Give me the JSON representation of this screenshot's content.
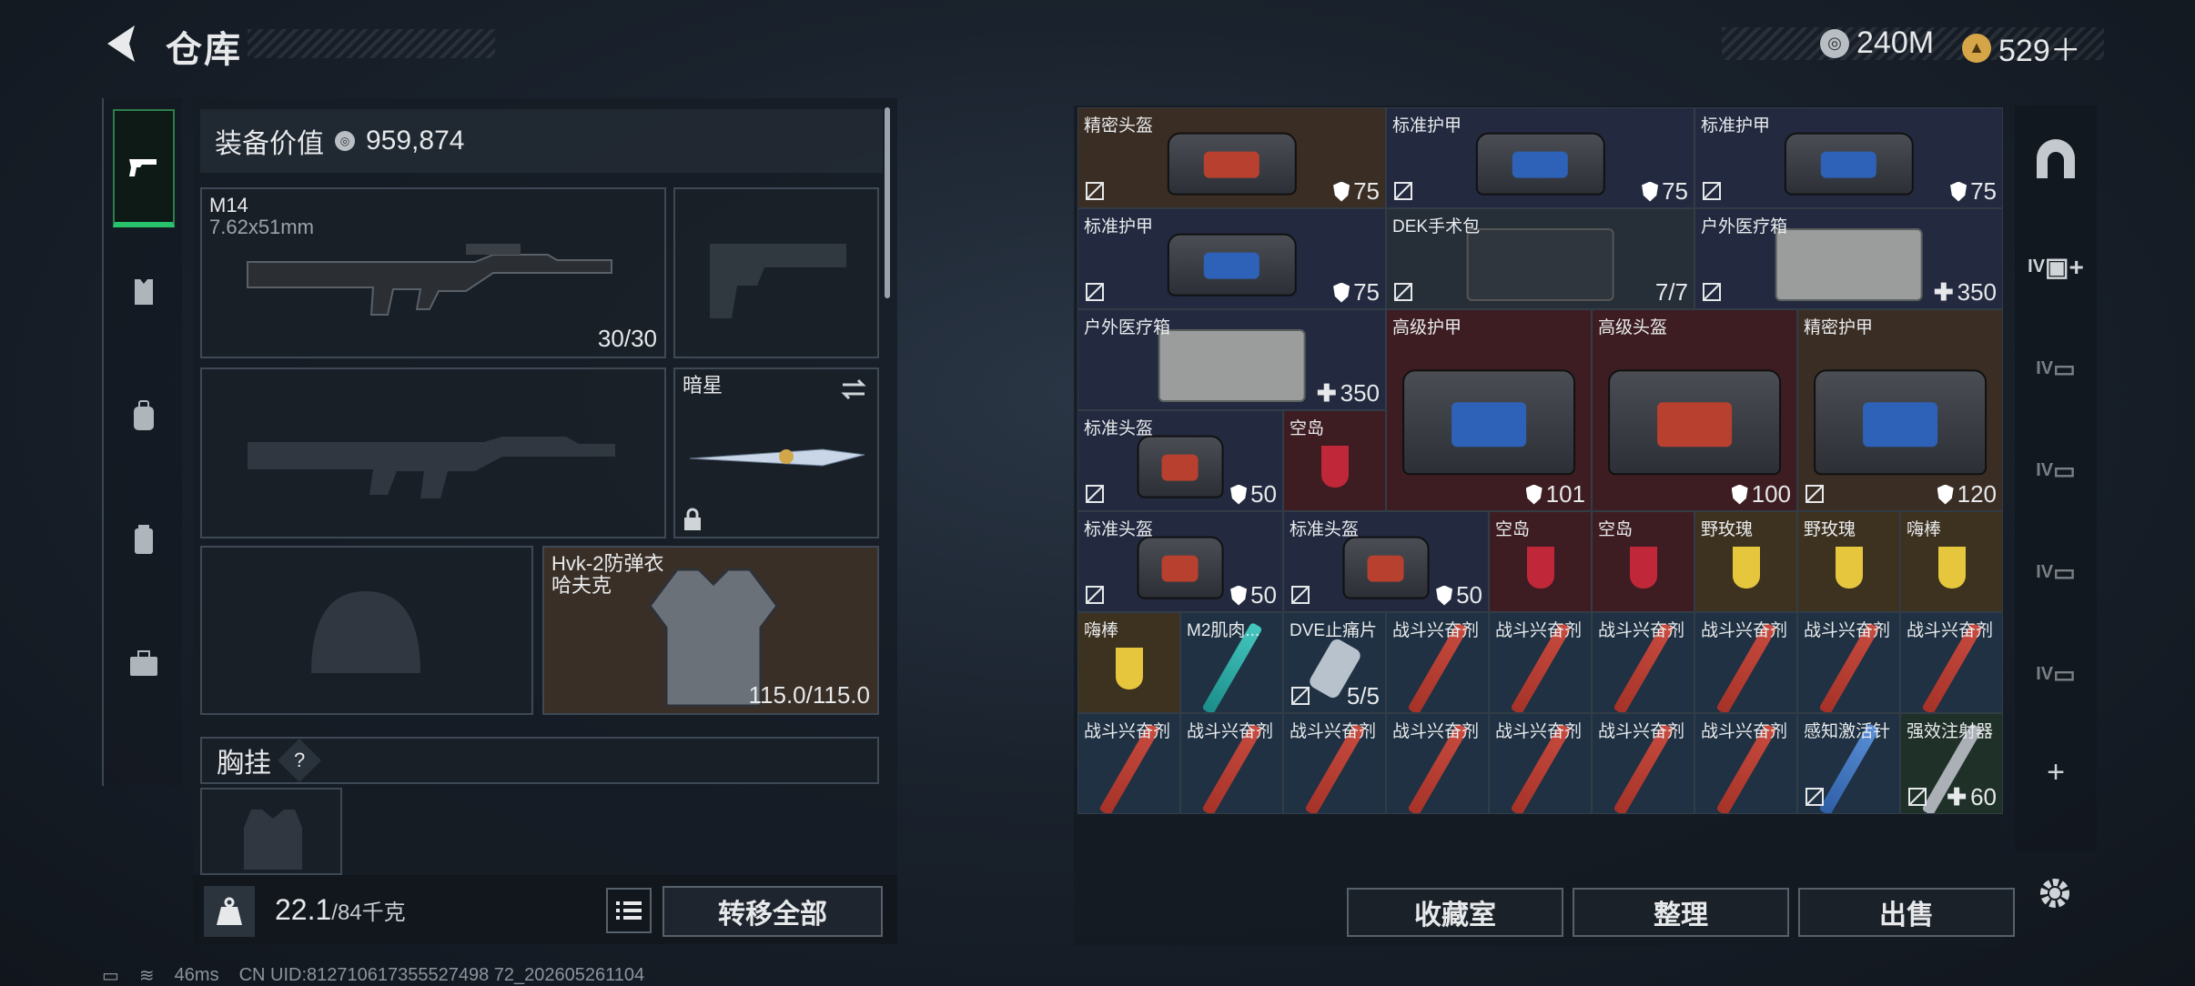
{
  "header": {
    "title": "仓库"
  },
  "currency": [
    {
      "icon": "silver-coin-icon",
      "value": "240M"
    },
    {
      "icon": "gold-coin-icon",
      "value": "529＋"
    }
  ],
  "loadout": {
    "value_label": "装备价值",
    "value": "959,874",
    "primary": {
      "name": "M14",
      "caliber": "7.62x51mm",
      "ammo": "30/30"
    },
    "melee": {
      "name": "暗星"
    },
    "armor": {
      "name": "Hvk-2防弹衣",
      "subname": "哈夫克",
      "durability": "115.0/115.0"
    },
    "chest_rig": {
      "label": "胸挂",
      "hint": "?"
    },
    "weight": {
      "current": "22.1",
      "max": "/84千克"
    },
    "transfer_all": "转移全部"
  },
  "stash": [
    [
      {
        "name": "精密头盔",
        "count": "75",
        "kind": "shield"
      },
      {
        "name": "标准护甲",
        "count": "75",
        "kind": "shield"
      },
      {
        "name": "标准护甲",
        "count": "75",
        "kind": "shield"
      }
    ],
    [
      {
        "name": "标准护甲",
        "count": "75",
        "kind": "shield"
      },
      {
        "name": "DEK手术包",
        "count": "7/7",
        "kind": "plain"
      },
      {
        "name": "户外医疗箱",
        "count": "350",
        "kind": "plus"
      }
    ],
    [
      {
        "name": "户外医疗箱",
        "count": "350",
        "kind": "plus"
      },
      {
        "name": "高级护甲",
        "count": "101",
        "kind": "shield"
      },
      {
        "name": "高级头盔",
        "count": "100",
        "kind": "shield"
      },
      {
        "name": "精密护甲",
        "count": "120",
        "kind": "shield"
      }
    ],
    [
      {
        "name": "标准头盔",
        "count": "50",
        "kind": "shield"
      },
      {
        "name": "空岛",
        "count": "",
        "kind": "none"
      }
    ],
    [
      {
        "name": "标准头盔",
        "count": "50",
        "kind": "shield"
      },
      {
        "name": "标准头盔",
        "count": "50",
        "kind": "shield"
      },
      {
        "name": "空岛",
        "count": "",
        "kind": "none"
      },
      {
        "name": "空岛",
        "count": "",
        "kind": "none"
      },
      {
        "name": "野玫瑰",
        "count": "",
        "kind": "none"
      },
      {
        "name": "野玫瑰",
        "count": "",
        "kind": "none"
      },
      {
        "name": "嗨棒",
        "count": "",
        "kind": "none"
      }
    ],
    [
      {
        "name": "嗨棒",
        "count": "",
        "kind": "none"
      },
      {
        "name": "M2肌肉...",
        "count": "",
        "kind": "none"
      },
      {
        "name": "DVE止痛片",
        "count": "5/5",
        "kind": "plain"
      },
      {
        "name": "战斗兴奋剂",
        "count": "",
        "kind": "none"
      },
      {
        "name": "战斗兴奋剂",
        "count": "",
        "kind": "none"
      },
      {
        "name": "战斗兴奋剂",
        "count": "",
        "kind": "none"
      },
      {
        "name": "战斗兴奋剂",
        "count": "",
        "kind": "none"
      },
      {
        "name": "战斗兴奋剂",
        "count": "",
        "kind": "none"
      },
      {
        "name": "战斗兴奋剂",
        "count": "",
        "kind": "none"
      }
    ],
    [
      {
        "name": "战斗兴奋剂",
        "count": "",
        "kind": "none"
      },
      {
        "name": "战斗兴奋剂",
        "count": "",
        "kind": "none"
      },
      {
        "name": "战斗兴奋剂",
        "count": "",
        "kind": "none"
      },
      {
        "name": "战斗兴奋剂",
        "count": "",
        "kind": "none"
      },
      {
        "name": "战斗兴奋剂",
        "count": "",
        "kind": "none"
      },
      {
        "name": "战斗兴奋剂",
        "count": "",
        "kind": "none"
      },
      {
        "name": "战斗兴奋剂",
        "count": "",
        "kind": "none"
      },
      {
        "name": "感知激活针",
        "count": "",
        "kind": "none"
      },
      {
        "name": "强效注射器",
        "count": "60",
        "kind": "plus"
      }
    ]
  ],
  "actions": {
    "collection": "收藏室",
    "sort": "整理",
    "sell": "出售"
  },
  "right_tabs": [
    "IV",
    "IV",
    "IV",
    "IV",
    "IV",
    "IV"
  ],
  "status": {
    "ping": "46ms",
    "uid": "CN UID:812710617355527498 72_202605261104"
  }
}
